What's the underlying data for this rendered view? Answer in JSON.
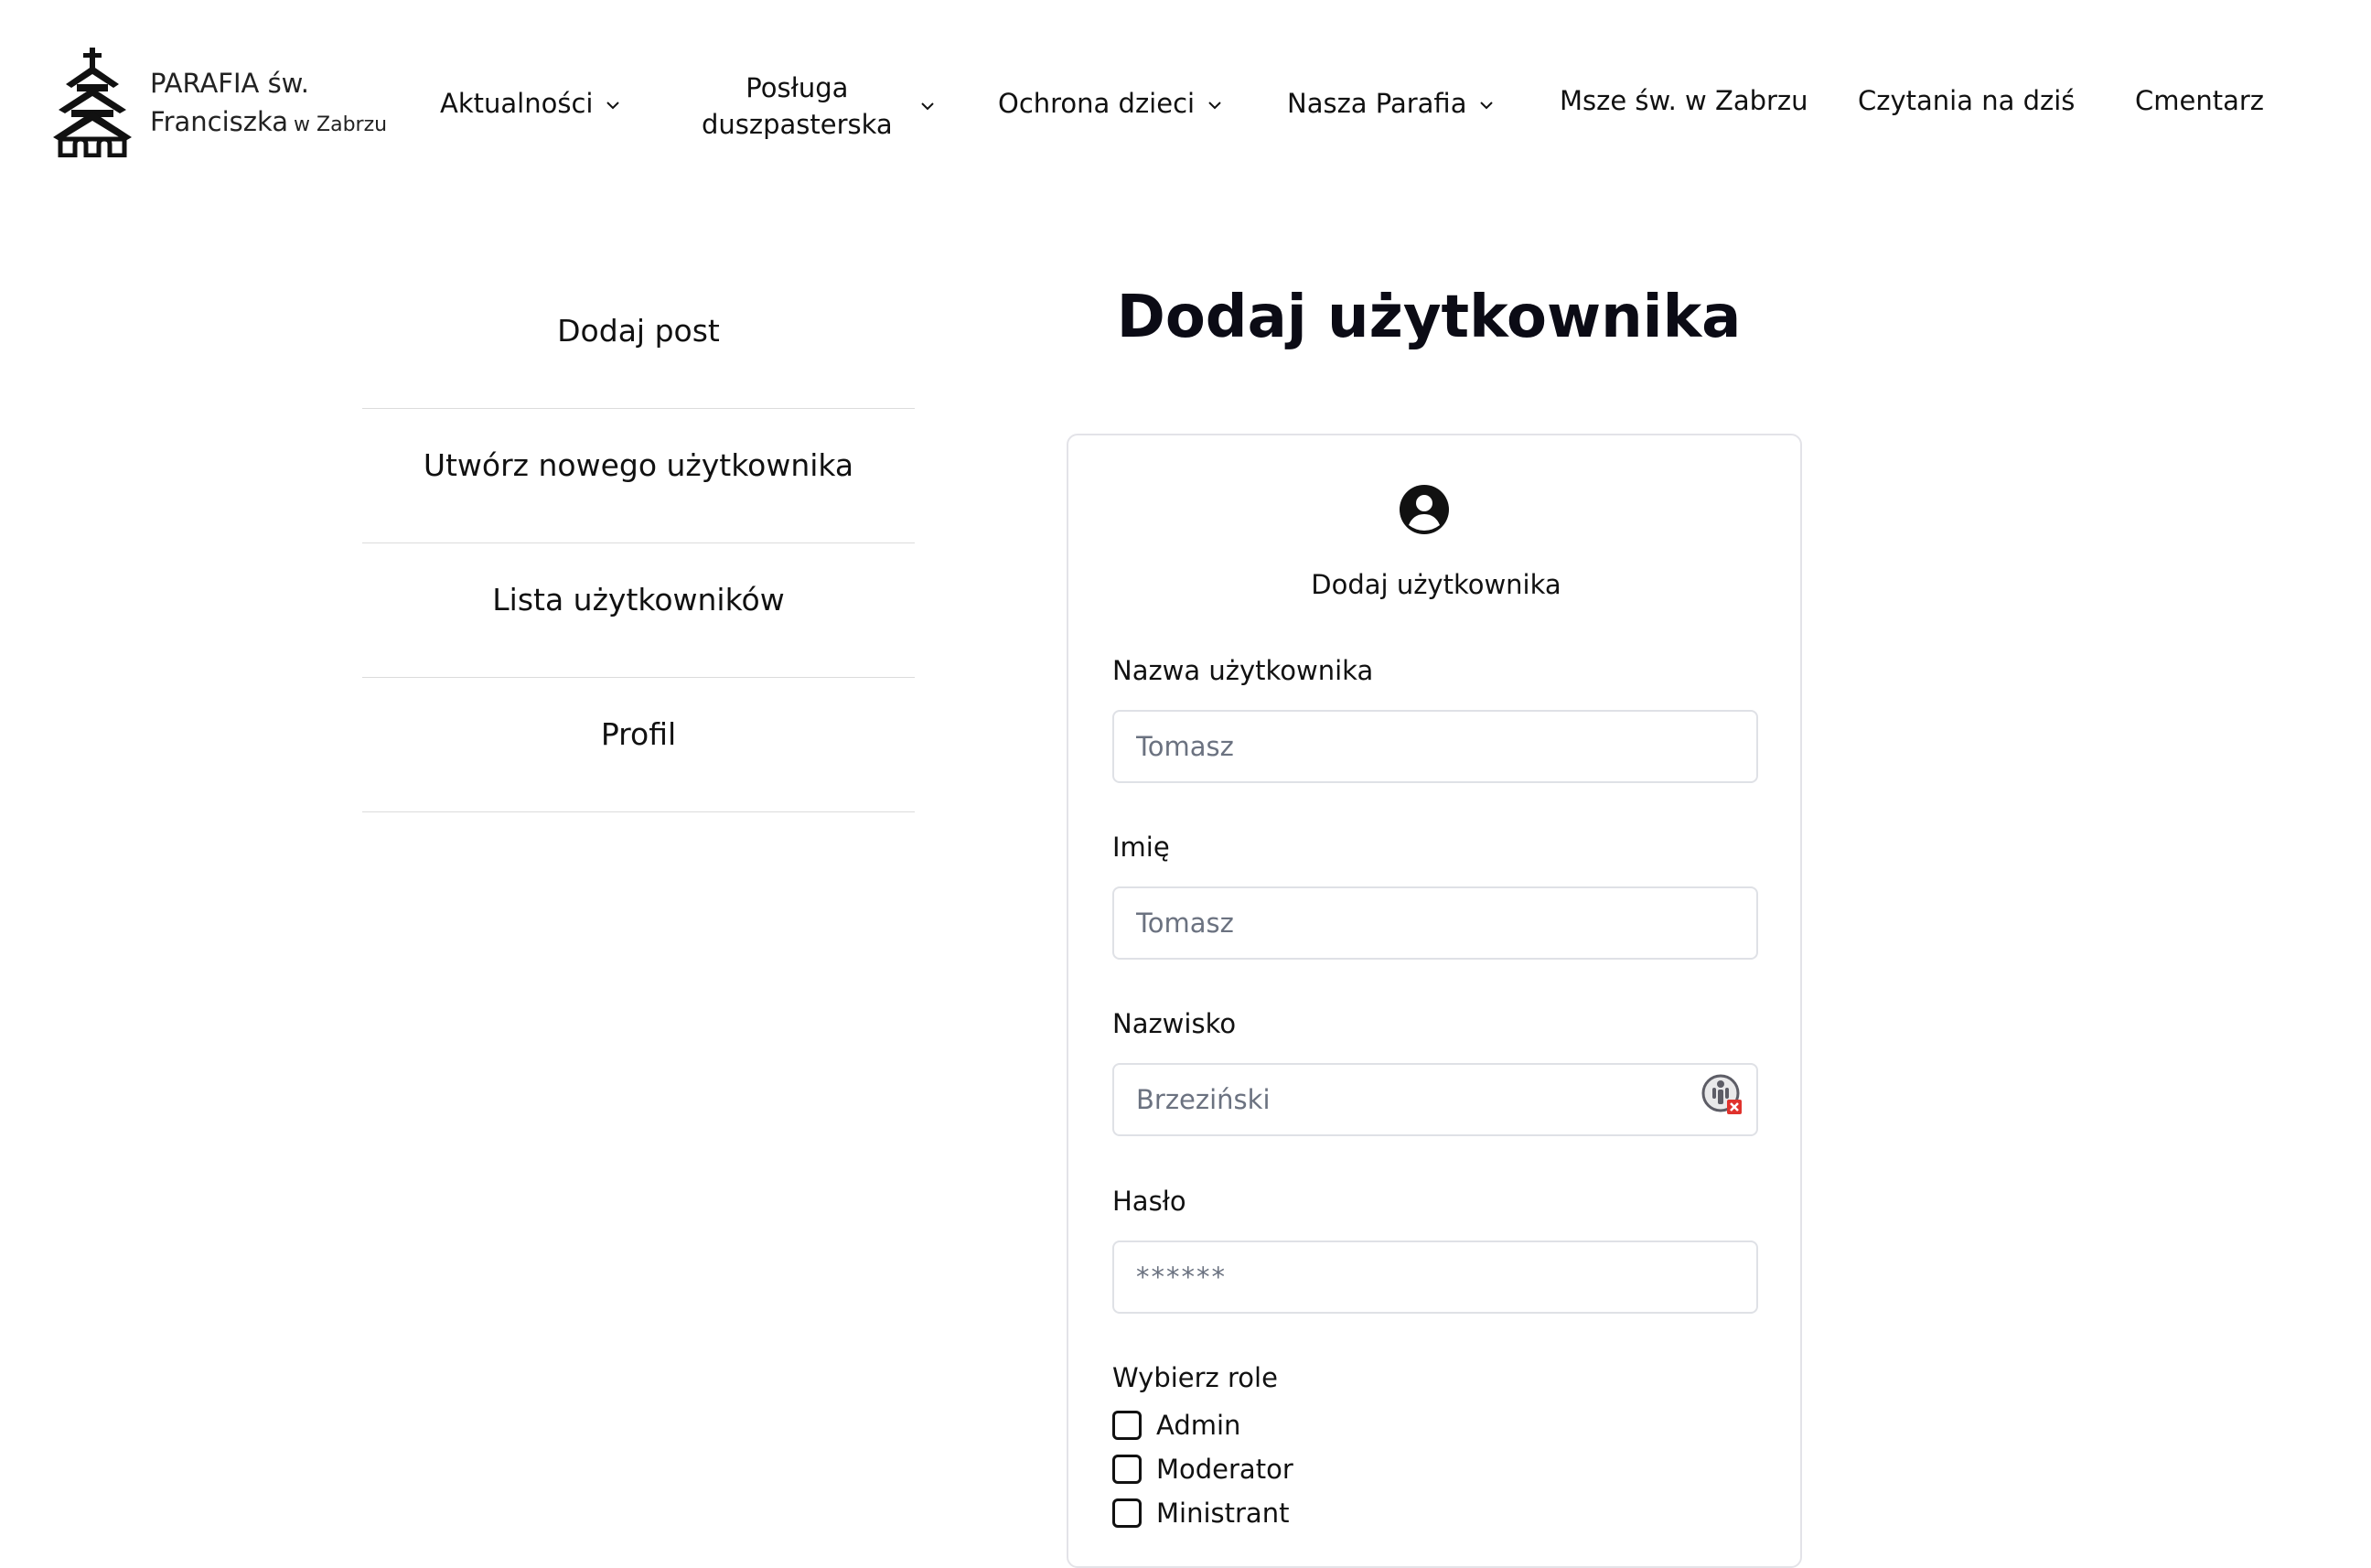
{
  "header": {
    "logo": {
      "line1": "PARAFIA św.",
      "line2": "Franciszka",
      "line2_small": "w Zabrzu",
      "icon": "church-icon"
    },
    "nav": [
      {
        "label": "Aktualności",
        "dropdown": true
      },
      {
        "label_line1": "Posługa",
        "label_line2": "duszpasterska",
        "dropdown": true
      },
      {
        "label": "Ochrona dzieci",
        "dropdown": true
      },
      {
        "label": "Nasza Parafia",
        "dropdown": true
      },
      {
        "label": "Msze św. w Zabrzu",
        "dropdown": false
      },
      {
        "label": "Czytania na dziś",
        "dropdown": false
      },
      {
        "label": "Cmentarz",
        "dropdown": false
      }
    ]
  },
  "sidebar": {
    "items": [
      {
        "label": "Dodaj post"
      },
      {
        "label": "Utwórz nowego użytkownika"
      },
      {
        "label": "Lista użytkowników"
      },
      {
        "label": "Profil"
      }
    ]
  },
  "main": {
    "title": "Dodaj użytkownika",
    "card": {
      "icon": "user-circle-icon",
      "title": "Dodaj użytkownika",
      "fields": {
        "username": {
          "label": "Nazwa użytkownika",
          "placeholder": "Tomasz",
          "value": ""
        },
        "first_name": {
          "label": "Imię",
          "placeholder": "Tomasz",
          "value": ""
        },
        "last_name": {
          "label": "Nazwisko",
          "placeholder": "Brzeziński",
          "value": ""
        },
        "password": {
          "label": "Hasło",
          "placeholder": "******",
          "value": ""
        }
      },
      "roles": {
        "label": "Wybierz role",
        "options": [
          {
            "label": "Admin",
            "checked": false
          },
          {
            "label": "Moderator",
            "checked": false
          },
          {
            "label": "Ministrant",
            "checked": false
          }
        ]
      },
      "autofill_icon": "password-manager-icon"
    }
  },
  "colors": {
    "text": "#111111",
    "title": "#0b0b15",
    "placeholder": "#6b7280",
    "border": "#dfe1e6",
    "divider": "#dcdcdc"
  }
}
